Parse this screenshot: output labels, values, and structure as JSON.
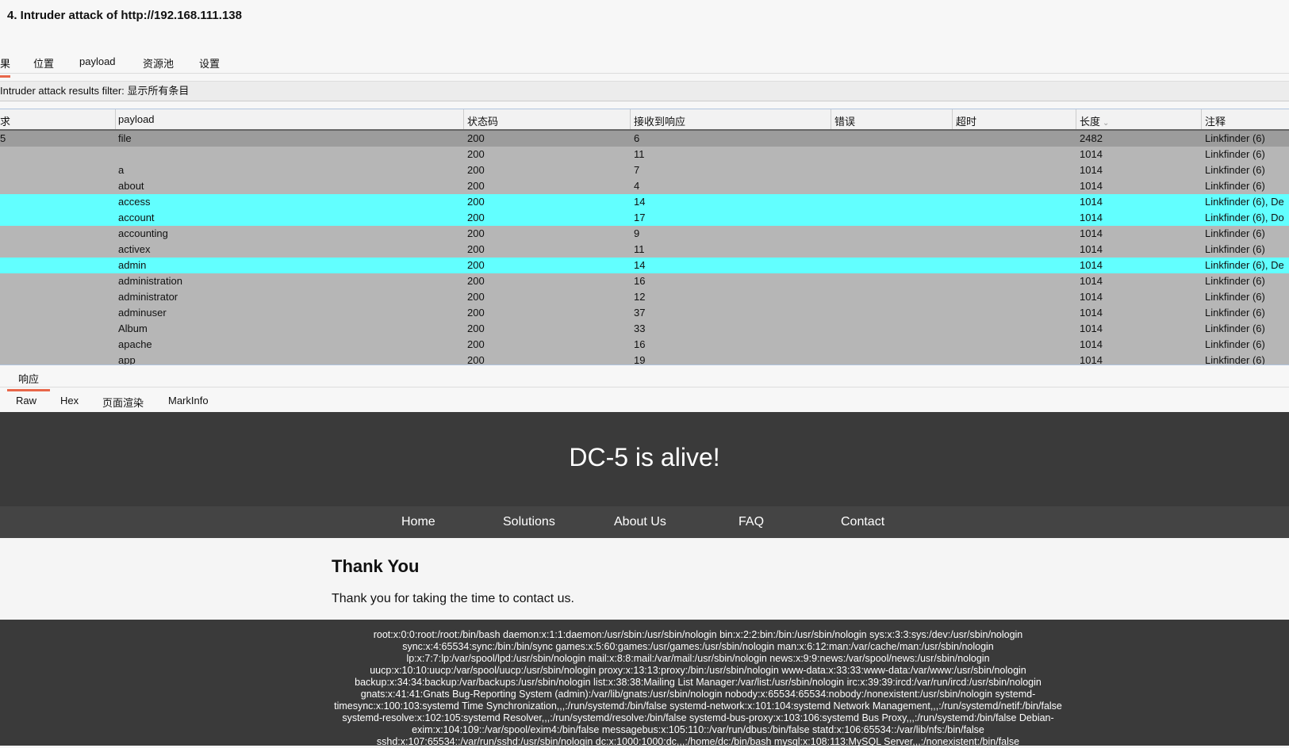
{
  "window": {
    "title": "4. Intruder attack of http://192.168.111.138"
  },
  "tabs": [
    {
      "label": "果",
      "active": true
    },
    {
      "label": "位置",
      "active": false
    },
    {
      "label": "payload",
      "active": false
    },
    {
      "label": "资源池",
      "active": false
    },
    {
      "label": "设置",
      "active": false
    }
  ],
  "filter": {
    "text": "Intruder attack results filter: 显示所有条目"
  },
  "table": {
    "headers": [
      "求",
      "payload",
      "状态码",
      "接收到响应",
      "错误",
      "超时",
      "长度",
      "注释"
    ],
    "rows": [
      {
        "req": "5",
        "payload": "file",
        "status": "200",
        "resp": "6",
        "error": "",
        "timeout": "",
        "length": "2482",
        "comment": "Linkfinder (6)",
        "style": "sel"
      },
      {
        "req": "",
        "payload": "",
        "status": "200",
        "resp": "11",
        "error": "",
        "timeout": "",
        "length": "1014",
        "comment": "Linkfinder (6)",
        "style": ""
      },
      {
        "req": "",
        "payload": "a",
        "status": "200",
        "resp": "7",
        "error": "",
        "timeout": "",
        "length": "1014",
        "comment": "Linkfinder (6)",
        "style": ""
      },
      {
        "req": "",
        "payload": "about",
        "status": "200",
        "resp": "4",
        "error": "",
        "timeout": "",
        "length": "1014",
        "comment": "Linkfinder (6)",
        "style": ""
      },
      {
        "req": "",
        "payload": "access",
        "status": "200",
        "resp": "14",
        "error": "",
        "timeout": "",
        "length": "1014",
        "comment": "Linkfinder (6), De",
        "style": "hl"
      },
      {
        "req": "",
        "payload": "account",
        "status": "200",
        "resp": "17",
        "error": "",
        "timeout": "",
        "length": "1014",
        "comment": "Linkfinder (6), Do",
        "style": "hl"
      },
      {
        "req": "",
        "payload": "accounting",
        "status": "200",
        "resp": "9",
        "error": "",
        "timeout": "",
        "length": "1014",
        "comment": "Linkfinder (6)",
        "style": ""
      },
      {
        "req": "",
        "payload": "activex",
        "status": "200",
        "resp": "11",
        "error": "",
        "timeout": "",
        "length": "1014",
        "comment": "Linkfinder (6)",
        "style": ""
      },
      {
        "req": "",
        "payload": "admin",
        "status": "200",
        "resp": "14",
        "error": "",
        "timeout": "",
        "length": "1014",
        "comment": "Linkfinder (6), De",
        "style": "hl"
      },
      {
        "req": "",
        "payload": "administration",
        "status": "200",
        "resp": "16",
        "error": "",
        "timeout": "",
        "length": "1014",
        "comment": "Linkfinder (6)",
        "style": ""
      },
      {
        "req": "",
        "payload": "administrator",
        "status": "200",
        "resp": "12",
        "error": "",
        "timeout": "",
        "length": "1014",
        "comment": "Linkfinder (6)",
        "style": ""
      },
      {
        "req": "",
        "payload": "adminuser",
        "status": "200",
        "resp": "37",
        "error": "",
        "timeout": "",
        "length": "1014",
        "comment": "Linkfinder (6)",
        "style": ""
      },
      {
        "req": "",
        "payload": "Album",
        "status": "200",
        "resp": "33",
        "error": "",
        "timeout": "",
        "length": "1014",
        "comment": "Linkfinder (6)",
        "style": ""
      },
      {
        "req": "",
        "payload": "apache",
        "status": "200",
        "resp": "16",
        "error": "",
        "timeout": "",
        "length": "1014",
        "comment": "Linkfinder (6)",
        "style": ""
      },
      {
        "req": "",
        "payload": "app",
        "status": "200",
        "resp": "19",
        "error": "",
        "timeout": "",
        "length": "1014",
        "comment": "Linkfinder (6)",
        "style": ""
      }
    ]
  },
  "detail_tab": {
    "label": "响应"
  },
  "view_tabs": [
    {
      "label": "Raw",
      "active": false
    },
    {
      "label": "Hex",
      "active": false
    },
    {
      "label": "页面渲染",
      "active": true
    },
    {
      "label": "MarkInfo",
      "active": false
    }
  ],
  "render": {
    "heading": "DC-5 is alive!",
    "nav": [
      "Home",
      "Solutions",
      "About Us",
      "FAQ",
      "Contact"
    ],
    "thank_heading": "Thank You",
    "thank_text": "Thank you for taking the time to contact us.",
    "passwd_lines": [
      "root:x:0:0:root:/root:/bin/bash daemon:x:1:1:daemon:/usr/sbin:/usr/sbin/nologin bin:x:2:2:bin:/bin:/usr/sbin/nologin sys:x:3:3:sys:/dev:/usr/sbin/nologin",
      "sync:x:4:65534:sync:/bin:/bin/sync games:x:5:60:games:/usr/games:/usr/sbin/nologin man:x:6:12:man:/var/cache/man:/usr/sbin/nologin",
      "lp:x:7:7:lp:/var/spool/lpd:/usr/sbin/nologin mail:x:8:8:mail:/var/mail:/usr/sbin/nologin news:x:9:9:news:/var/spool/news:/usr/sbin/nologin",
      "uucp:x:10:10:uucp:/var/spool/uucp:/usr/sbin/nologin proxy:x:13:13:proxy:/bin:/usr/sbin/nologin www-data:x:33:33:www-data:/var/www:/usr/sbin/nologin",
      "backup:x:34:34:backup:/var/backups:/usr/sbin/nologin list:x:38:38:Mailing List Manager:/var/list:/usr/sbin/nologin irc:x:39:39:ircd:/var/run/ircd:/usr/sbin/nologin",
      "gnats:x:41:41:Gnats Bug-Reporting System (admin):/var/lib/gnats:/usr/sbin/nologin nobody:x:65534:65534:nobody:/nonexistent:/usr/sbin/nologin systemd-",
      "timesync:x:100:103:systemd Time Synchronization,,,:/run/systemd:/bin/false systemd-network:x:101:104:systemd Network Management,,,:/run/systemd/netif:/bin/false",
      "systemd-resolve:x:102:105:systemd Resolver,,,:/run/systemd/resolve:/bin/false systemd-bus-proxy:x:103:106:systemd Bus Proxy,,,:/run/systemd:/bin/false Debian-",
      "exim:x:104:109::/var/spool/exim4:/bin/false messagebus:x:105:110::/var/run/dbus:/bin/false statd:x:106:65534::/var/lib/nfs:/bin/false",
      "sshd:x:107:65534::/var/run/sshd:/usr/sbin/nologin dc:x:1000:1000:dc,,,:/home/dc:/bin/bash mysql:x:108:113:MySQL Server,,,:/nonexistent:/bin/false"
    ]
  },
  "colors": {
    "accent": "#e8674a",
    "row_gray": "#b6b6b6",
    "row_highlight": "#62ffff",
    "dark_bg": "#3a3a3a"
  }
}
